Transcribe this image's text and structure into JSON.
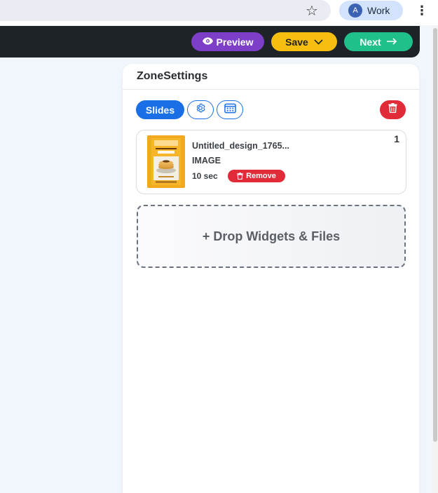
{
  "browser": {
    "bookmark_icon": "star-icon",
    "profile": {
      "avatar_letter": "A",
      "name": "Work"
    },
    "menu_icon": "kebab-menu-icon"
  },
  "toolbar": {
    "preview_label": "Preview",
    "save_label": "Save",
    "next_label": "Next",
    "colors": {
      "preview": "#7e3fc8",
      "save": "#f6be0e",
      "next": "#20c08a",
      "bar": "#1e2327"
    }
  },
  "panel": {
    "title": "ZoneSettings",
    "tabs": {
      "slides_label": "Slides",
      "settings_icon": "gear-icon",
      "schedule_icon": "calendar-icon"
    },
    "delete_icon": "trash-icon",
    "slides": [
      {
        "index": "1",
        "name": "Untitled_design_1765...",
        "type": "IMAGE",
        "duration": "10 sec",
        "remove_label": "Remove"
      }
    ],
    "drop_zone_label": "+ Drop Widgets & Files",
    "colors": {
      "primary": "#1a6fe6",
      "danger": "#e12b38"
    }
  }
}
